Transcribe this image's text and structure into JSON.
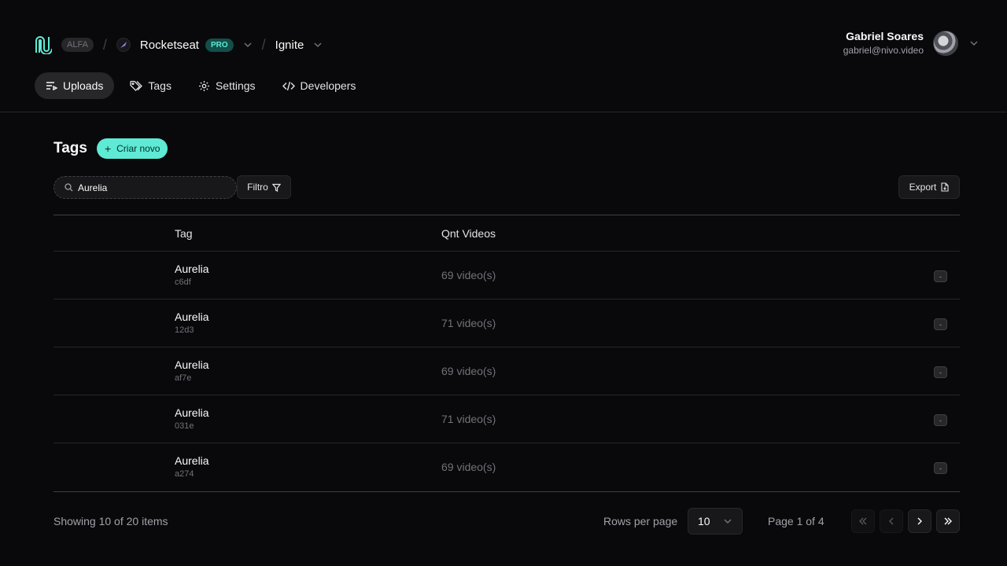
{
  "header": {
    "env_badge": "ALFA",
    "org": {
      "name": "Rocketseat",
      "plan_badge": "PRO"
    },
    "project": {
      "name": "Ignite"
    },
    "user": {
      "name": "Gabriel Soares",
      "email": "gabriel@nivo.video"
    },
    "separator": "/"
  },
  "nav": {
    "items": [
      {
        "label": "Uploads",
        "icon": "uploads-icon",
        "active": true
      },
      {
        "label": "Tags",
        "icon": "tag-icon",
        "active": false
      },
      {
        "label": "Settings",
        "icon": "gear-icon",
        "active": false
      },
      {
        "label": "Developers",
        "icon": "code-icon",
        "active": false
      }
    ]
  },
  "page": {
    "title": "Tags",
    "create_label": "Criar novo"
  },
  "toolbar": {
    "search_value": "Aurelia",
    "filter_label": "Filtro",
    "export_label": "Export"
  },
  "table": {
    "columns": [
      "Tag",
      "Qnt Videos"
    ],
    "rows": [
      {
        "name": "Aurelia",
        "id": "c6df",
        "count": "69 video(s)",
        "action": "-"
      },
      {
        "name": "Aurelia",
        "id": "12d3",
        "count": "71 video(s)",
        "action": "-"
      },
      {
        "name": "Aurelia",
        "id": "af7e",
        "count": "69 video(s)",
        "action": "-"
      },
      {
        "name": "Aurelia",
        "id": "031e",
        "count": "71 video(s)",
        "action": "-"
      },
      {
        "name": "Aurelia",
        "id": "a274",
        "count": "69 video(s)",
        "action": "-"
      }
    ]
  },
  "pagination": {
    "showing": "Showing 10 of 20 items",
    "rows_per_page_label": "Rows per page",
    "rows_per_page_value": "10",
    "page_info": "Page 1 of 4"
  },
  "colors": {
    "background": "#09090b",
    "accent": "#5eead4",
    "border": "#27272a"
  }
}
